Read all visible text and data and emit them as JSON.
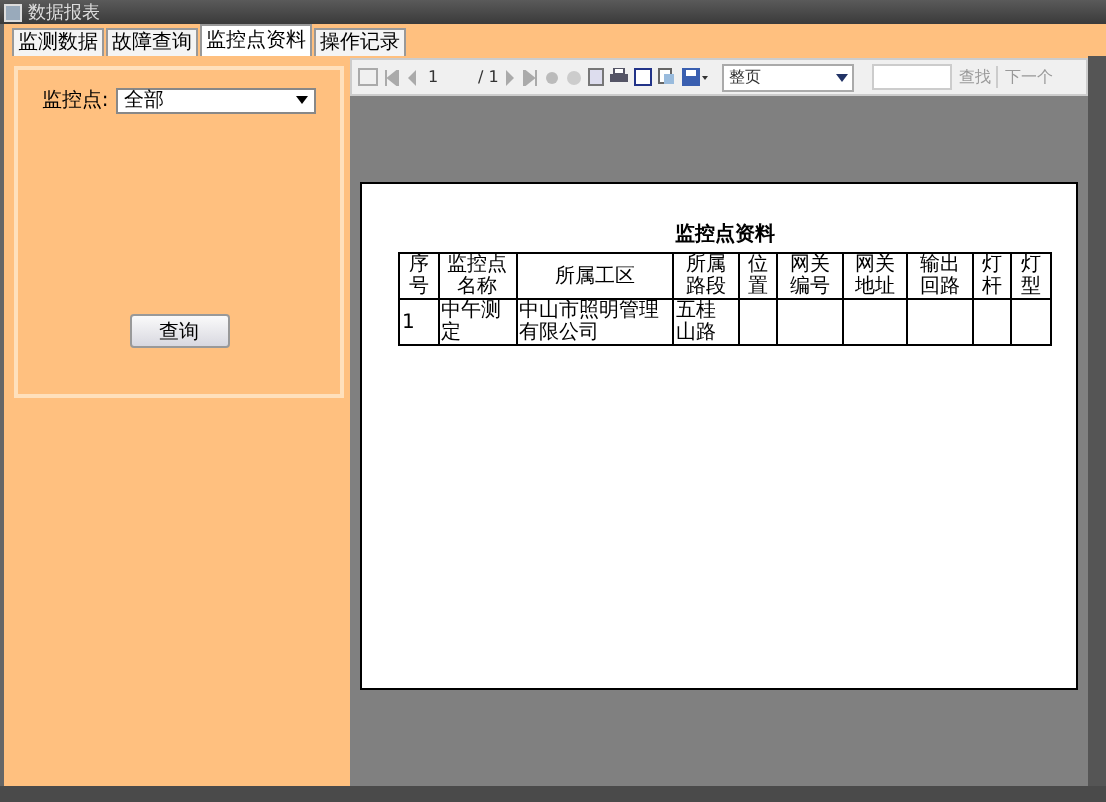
{
  "window": {
    "title": "数据报表"
  },
  "tabs": [
    {
      "label": "监测数据",
      "selected": false
    },
    {
      "label": "故障查询",
      "selected": false
    },
    {
      "label": "监控点资料",
      "selected": true
    },
    {
      "label": "操作记录",
      "selected": false
    }
  ],
  "filter": {
    "label": "监控点:",
    "value": "全部",
    "button": "查询"
  },
  "toolbar": {
    "page": "1",
    "total": "/ 1",
    "zoom": "整页",
    "find": "查找",
    "next": "下一个"
  },
  "report": {
    "title": "监控点资料",
    "columns": [
      "序号",
      "监控点名称",
      "所属工区",
      "所属路段",
      "位置",
      "网关编号",
      "网关地址",
      "输出回路",
      "灯杆",
      "灯型"
    ],
    "rows": [
      [
        "1",
        "中午测定",
        "中山市照明管理有限公司",
        "五桂山路",
        "",
        "",
        "",
        "",
        "",
        ""
      ]
    ]
  }
}
